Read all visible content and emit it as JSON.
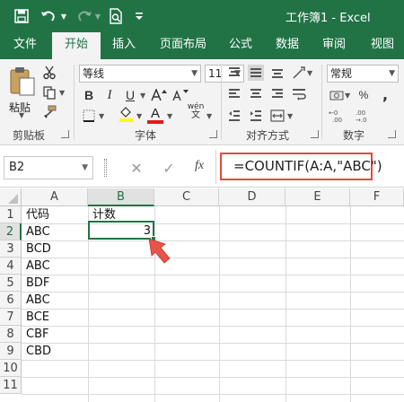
{
  "window": {
    "title": "工作簿1  -  Excel"
  },
  "tabs": [
    {
      "label": "文件",
      "active": false
    },
    {
      "label": "开始",
      "active": true
    },
    {
      "label": "插入",
      "active": false
    },
    {
      "label": "页面布局",
      "active": false
    },
    {
      "label": "公式",
      "active": false
    },
    {
      "label": "数据",
      "active": false
    },
    {
      "label": "审阅",
      "active": false
    },
    {
      "label": "视图",
      "active": false
    }
  ],
  "ribbon": {
    "clipboard": {
      "paste_label": "粘贴",
      "group_label": "剪贴板"
    },
    "font": {
      "name": "等线",
      "size": "11",
      "group_label": "字体"
    },
    "alignment": {
      "group_label": "对齐方式"
    },
    "number": {
      "format": "常规",
      "group_label": "数字"
    },
    "icons": {
      "bold": "B",
      "italic": "I",
      "underline": "U",
      "font_color": "A",
      "phonetic": "wén"
    }
  },
  "formula_bar": {
    "name_box": "B2",
    "fx": "fx",
    "formula": "=COUNTIF(A:A,\"ABC\")"
  },
  "sheet": {
    "columns": [
      "A",
      "B",
      "C",
      "D",
      "E",
      "F"
    ],
    "rows": [
      "1",
      "2",
      "3",
      "4",
      "5",
      "6",
      "7",
      "8",
      "9",
      "10",
      "11"
    ],
    "column_a": [
      "代码",
      "ABC",
      "BCD",
      "ABC",
      "BDF",
      "ABC",
      "BCE",
      "CBF",
      "CBD"
    ],
    "b1": "计数",
    "b2": "3",
    "selected_cell": "B2"
  },
  "colors": {
    "accent": "#217346",
    "highlight_box": "#e04a3c",
    "arrow": "#e8534a"
  }
}
